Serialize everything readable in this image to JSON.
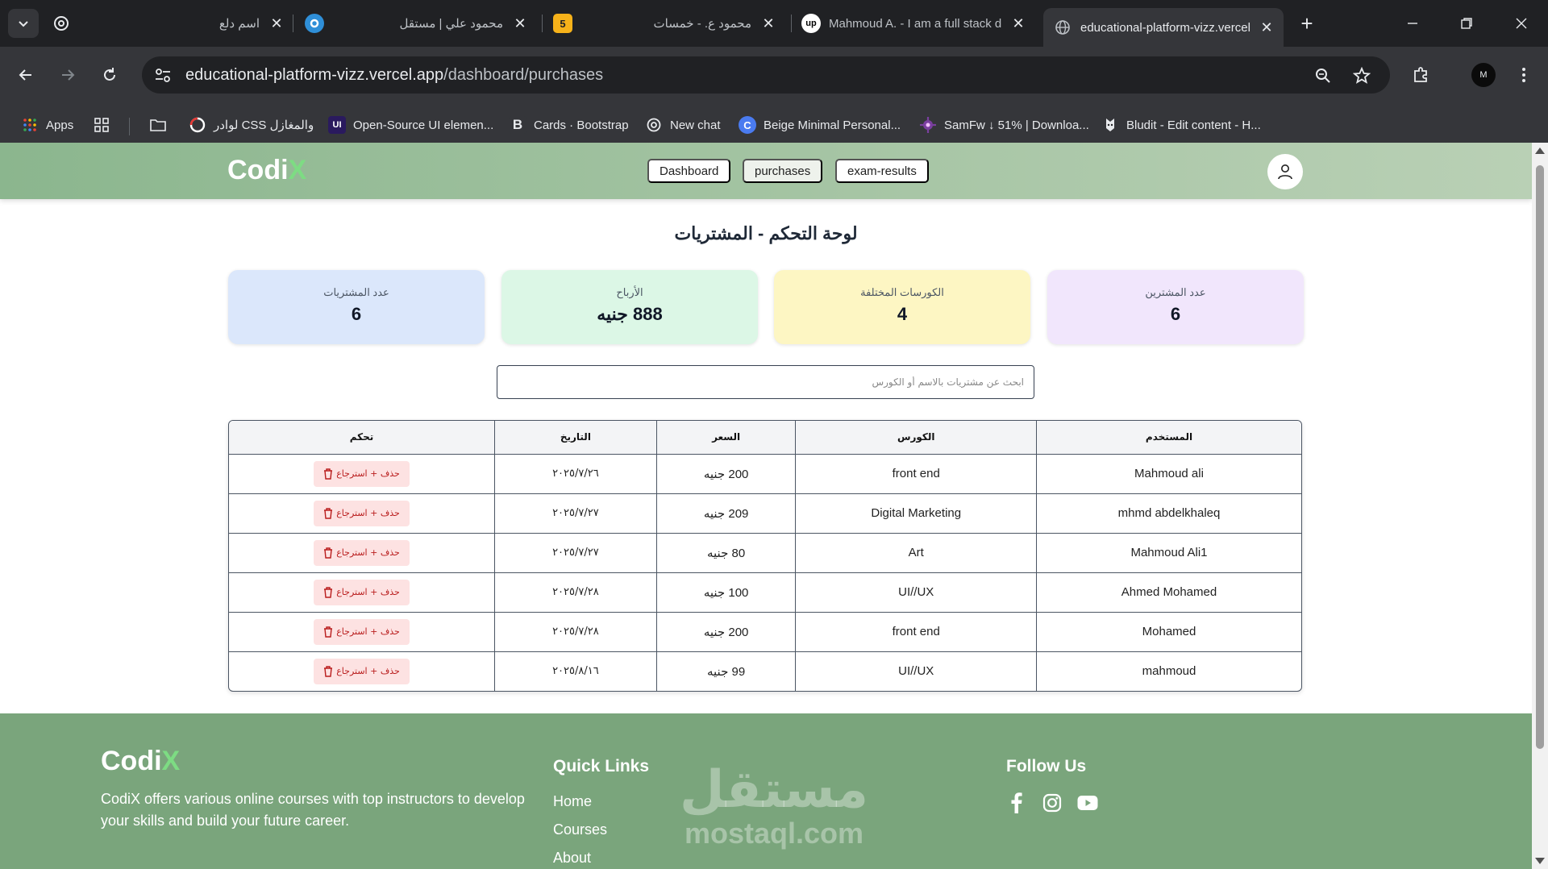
{
  "browser": {
    "tabs": [
      {
        "title": "اسم دلع",
        "favicon": "openai-icon"
      },
      {
        "title": "محمود علي | مستقل",
        "favicon": "mostaql-icon"
      },
      {
        "title": "محمود ع. - خمسات",
        "favicon": "khamsat-icon"
      },
      {
        "title": "Mahmoud A. - I am a full stack developer",
        "favicon": "upwork-icon"
      },
      {
        "title": "educational-platform-vizz.vercel.app",
        "favicon": "globe-icon",
        "active": true
      }
    ],
    "url_host": "educational-platform-vizz.vercel.app",
    "url_path": "/dashboard/purchases",
    "bookmarks": [
      {
        "label": "Apps",
        "icon": "apps-grid-icon"
      },
      {
        "label": "",
        "icon": "tab-groups-icon"
      },
      {
        "label": "",
        "icon": "folder-icon"
      },
      {
        "label": "لوادر CSS والمغازل",
        "icon": "loader-icon"
      },
      {
        "label": "Open-Source UI elemen...",
        "icon": "uiverse-icon"
      },
      {
        "label": "Cards · Bootstrap",
        "icon": "bootstrap-icon"
      },
      {
        "label": "New chat",
        "icon": "openai-icon"
      },
      {
        "label": "Beige Minimal Personal...",
        "icon": "canva-icon"
      },
      {
        "label": "SamFw ↓ 51% | Downloa...",
        "icon": "samfw-icon"
      },
      {
        "label": "Bludit - Edit content - H...",
        "icon": "bludit-icon"
      }
    ]
  },
  "header": {
    "logo_main": "Codi",
    "logo_accent": "X",
    "nav": [
      "Dashboard",
      "purchases",
      "exam-results"
    ],
    "active_nav": "purchases"
  },
  "page": {
    "title": "لوحة التحكم - المشتريات",
    "stats": [
      {
        "label": "عدد المشتريات",
        "value": "6",
        "bg": "#dbe7fb"
      },
      {
        "label": "الأرباح",
        "value": "888 جنيه",
        "bg": "#dcf7e6"
      },
      {
        "label": "الكورسات المختلفة",
        "value": "4",
        "bg": "#fdf6c3"
      },
      {
        "label": "عدد المشترين",
        "value": "6",
        "bg": "#f1e6fc"
      }
    ],
    "search_placeholder": "ابحث عن مشتريات بالاسم أو الكورس"
  },
  "table": {
    "headers": {
      "user": "المستخدم",
      "course": "الكورس",
      "price": "السعر",
      "date": "التاريخ",
      "actions": "تحكم"
    },
    "action_label": "حذف + استرجاع",
    "rows": [
      {
        "user": "Mahmoud ali",
        "course": "front end",
        "price": "200 جنيه",
        "date": "٢٠٢٥/٧/٢٦"
      },
      {
        "user": "mhmd abdelkhaleq",
        "course": "Digital Marketing",
        "price": "209 جنيه",
        "date": "٢٠٢٥/٧/٢٧"
      },
      {
        "user": "Mahmoud Ali1",
        "course": "Art",
        "price": "80 جنيه",
        "date": "٢٠٢٥/٧/٢٧"
      },
      {
        "user": "Ahmed Mohamed",
        "course": "UI//UX",
        "price": "100 جنيه",
        "date": "٢٠٢٥/٧/٢٨"
      },
      {
        "user": "Mohamed",
        "course": "front end",
        "price": "200 جنيه",
        "date": "٢٠٢٥/٧/٢٨"
      },
      {
        "user": "mahmoud",
        "course": "UI//UX",
        "price": "99 جنيه",
        "date": "٢٠٢٥/٨/١٦"
      }
    ]
  },
  "footer": {
    "logo_main": "Codi",
    "logo_accent": "X",
    "description": "CodiX offers various online courses with top instructors to develop your skills and build your future career.",
    "quick_links_heading": "Quick Links",
    "quick_links": [
      "Home",
      "Courses",
      "About"
    ],
    "follow_heading": "Follow Us",
    "social": [
      "facebook-icon",
      "instagram-icon",
      "youtube-icon"
    ],
    "watermark_ar": "مستقل",
    "watermark_en": "mostaql.com"
  },
  "colors": {
    "header_green": "#8bb68e",
    "footer_green": "#7aa57c",
    "logo_accent": "#7ddc83",
    "delete_bg": "#fde2e2",
    "delete_text": "#b91c1c"
  }
}
